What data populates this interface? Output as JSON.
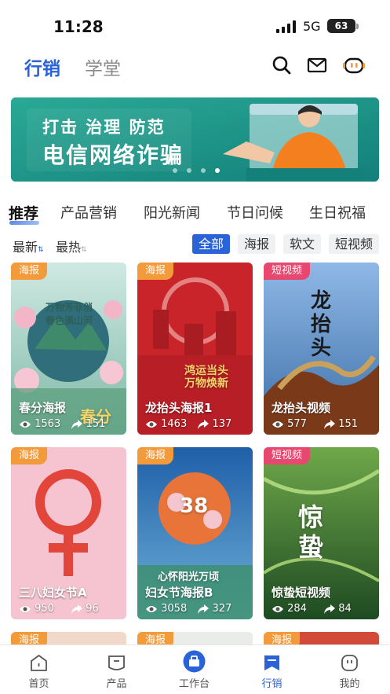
{
  "status_bar": {
    "time": "11:28",
    "network": "5G",
    "battery": "63"
  },
  "header": {
    "tabs": [
      {
        "label": "行销",
        "active": true
      },
      {
        "label": "学堂",
        "active": false
      }
    ],
    "icons": [
      "search-icon",
      "mail-icon",
      "robot-assistant-icon"
    ]
  },
  "banner": {
    "line1": "打击 治理 防范",
    "line2": "电信网络诈骗",
    "dots": 4,
    "active_dot": 4
  },
  "categories": [
    {
      "label": "推荐",
      "active": true
    },
    {
      "label": "产品营销",
      "active": false
    },
    {
      "label": "阳光新闻",
      "active": false
    },
    {
      "label": "节日问候",
      "active": false
    },
    {
      "label": "生日祝福",
      "active": false
    }
  ],
  "sort": {
    "newest": "最新",
    "hottest": "最热"
  },
  "filters": [
    {
      "label": "全部",
      "active": true
    },
    {
      "label": "海报",
      "active": false
    },
    {
      "label": "软文",
      "active": false
    },
    {
      "label": "短视频",
      "active": false
    }
  ],
  "cards": [
    {
      "tag": "海报",
      "title": "春分海报",
      "views": "1563",
      "shares": "151",
      "art_text": "万物芳菲俏 春色满山河",
      "big_text": "春分"
    },
    {
      "tag": "海报",
      "title": "龙抬头海报1",
      "views": "1463",
      "shares": "137",
      "art_text": "鸿运当头 万物焕新"
    },
    {
      "tag": "短视频",
      "title": "龙抬头视频",
      "views": "577",
      "shares": "151",
      "big_text": "龙抬头"
    },
    {
      "tag": "海报",
      "title": "三八妇女节A",
      "views": "950",
      "shares": "96"
    },
    {
      "tag": "海报",
      "title": "妇女节海报B",
      "views": "3058",
      "shares": "327",
      "art_text": "心怀阳光万顷",
      "big_text": "38"
    },
    {
      "tag": "短视频",
      "title": "惊蛰短视频",
      "views": "284",
      "shares": "84",
      "big_text": "惊蛰"
    },
    {
      "tag": "海报"
    },
    {
      "tag": "海报"
    },
    {
      "tag": "海报"
    }
  ],
  "bottom_nav": [
    {
      "label": "首页",
      "icon": "home-icon",
      "active": false
    },
    {
      "label": "产品",
      "icon": "product-icon",
      "active": false
    },
    {
      "label": "工作台",
      "icon": "workbench-icon",
      "active": false
    },
    {
      "label": "行销",
      "icon": "marketing-icon",
      "active": true
    },
    {
      "label": "我的",
      "icon": "profile-icon",
      "active": false
    }
  ],
  "colors": {
    "accent": "#2a62d8",
    "poster_tag": "#f39a3b",
    "video_tag": "#e6486f",
    "banner_bg": "#1f9b8a"
  }
}
